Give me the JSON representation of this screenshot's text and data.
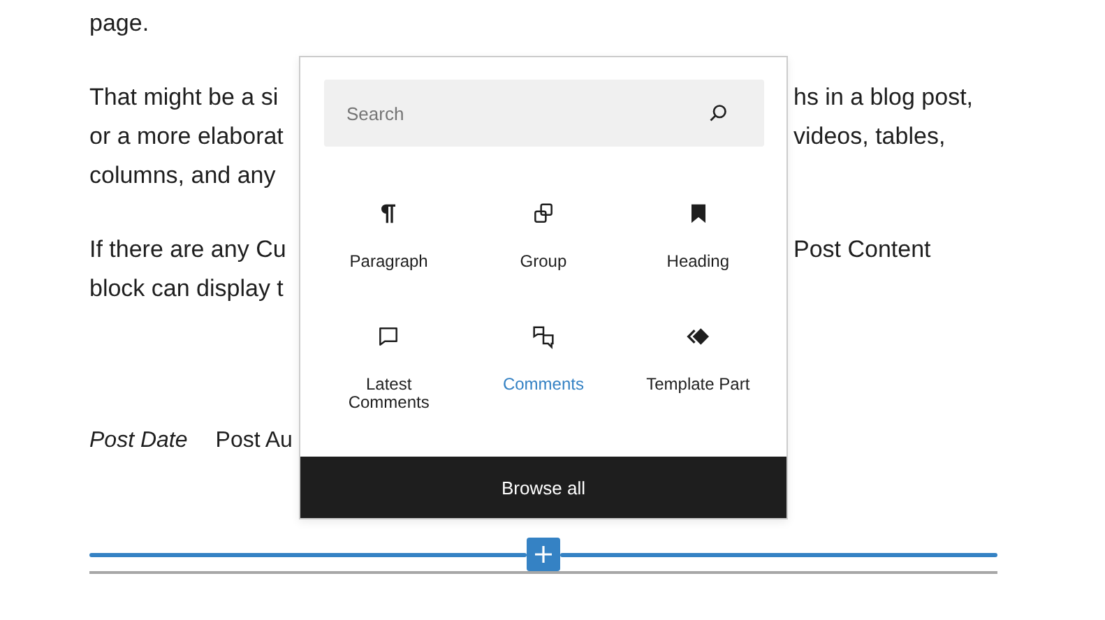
{
  "content": {
    "paragraphs": [
      {
        "lines": [
          {
            "left": "page."
          }
        ]
      },
      {
        "lines": [
          {
            "left": "That might be a si",
            "right": "hs in a blog post,"
          },
          {
            "left": "or a more elaborat",
            "right": "videos, tables,"
          },
          {
            "left": "columns, and any"
          }
        ]
      },
      {
        "lines": [
          {
            "left": "If there are any Cu",
            "right": "Post Content"
          },
          {
            "left": "block can display t"
          }
        ]
      }
    ],
    "meta": [
      {
        "text": "Post Date",
        "italic": true
      },
      {
        "text": "Post Au",
        "italic": false
      }
    ]
  },
  "inserter": {
    "search": {
      "placeholder": "Search"
    },
    "blocks": [
      {
        "label": "Paragraph",
        "selected": false
      },
      {
        "label": "Group",
        "selected": false
      },
      {
        "label": "Heading",
        "selected": false
      },
      {
        "label": "Latest Comments",
        "selected": false
      },
      {
        "label": "Comments",
        "selected": true
      },
      {
        "label": "Template Part",
        "selected": false
      }
    ],
    "browse_all": "Browse all"
  }
}
